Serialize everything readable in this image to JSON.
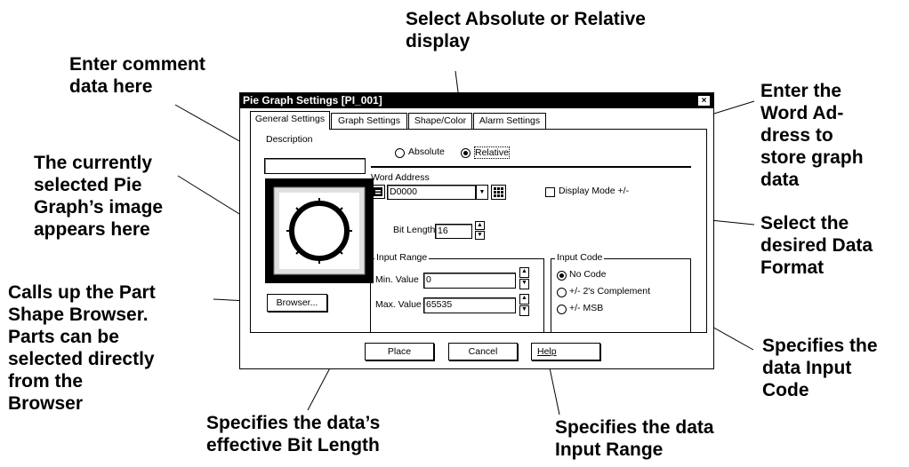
{
  "callouts": {
    "select_display": "Select Absolute or Relative\ndisplay",
    "comment": "Enter comment\ndata here",
    "word_address": "Enter the\nWord Ad-\ndress to\nstore graph\ndata",
    "image": "The currently\nselected Pie\nGraph’s image\nappears here",
    "data_format": "Select the\ndesired Data\nFormat",
    "browser": "Calls up the Part\nShape Browser.\nParts can be\nselected directly\nfrom the\nBrowser",
    "input_code": "Specifies the\ndata Input\nCode",
    "bit_length": "Specifies the data’s\neffective Bit Length",
    "input_range": "Specifies the data\nInput Range"
  },
  "dialog": {
    "title": "Pie Graph Settings [PI_001]",
    "close_glyph": "×",
    "tabs": [
      {
        "label": "General Settings",
        "active": true
      },
      {
        "label": "Graph Settings",
        "active": false
      },
      {
        "label": "Shape/Color",
        "active": false
      },
      {
        "label": "Alarm Settings",
        "active": false
      }
    ],
    "description_label": "Description",
    "description_value": "",
    "display_mode": {
      "absolute_label": "Absolute",
      "relative_label": "Relative",
      "selected": "Relative"
    },
    "word_address_label": "Word Address",
    "word_address_value": "D0000",
    "display_mode_checkbox_label": "Display Mode +/-",
    "display_mode_checked": false,
    "bit_length_label": "Bit Length",
    "bit_length_value": "16",
    "input_range": {
      "title": "Input Range",
      "min_label": "Min. Value",
      "min_value": "0",
      "max_label": "Max. Value",
      "max_value": "65535"
    },
    "input_code": {
      "title": "Input Code",
      "options": [
        "No Code",
        "+/- 2's Complement",
        "+/- MSB"
      ],
      "selected": "No Code"
    },
    "browser_button": "Browser...",
    "place_button": "Place",
    "cancel_button": "Cancel",
    "help_button": "Help",
    "arrow_up": "▲",
    "arrow_down": "▼"
  }
}
